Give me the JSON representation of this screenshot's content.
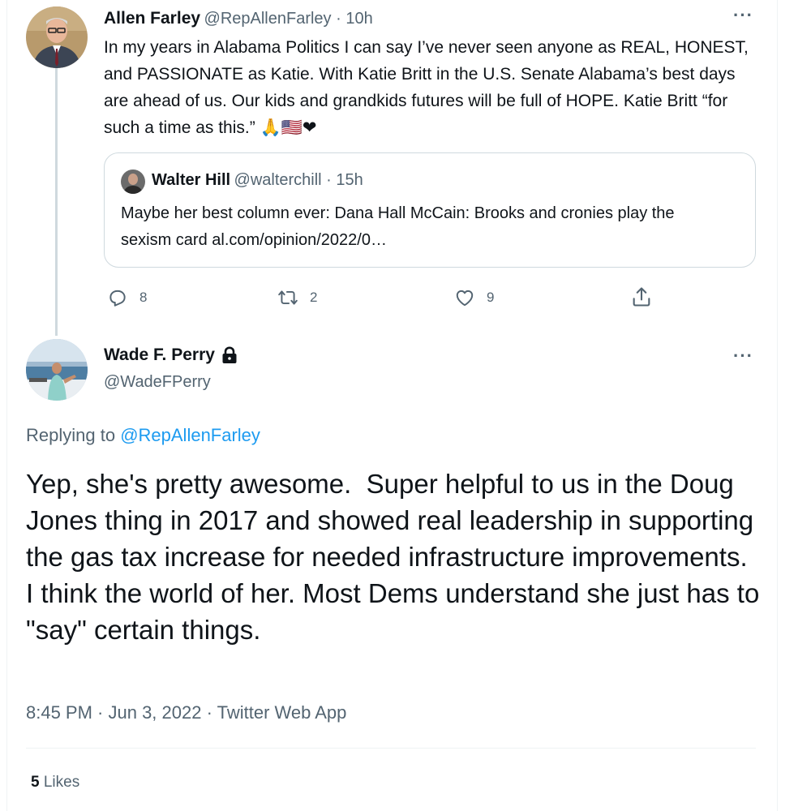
{
  "colors": {
    "accent": "#1d9bf0",
    "muted": "#536471",
    "text": "#0f1419",
    "border": "#cfd9de"
  },
  "parent_tweet": {
    "author_name": "Allen Farley",
    "handle_and_time": "@RepAllenFarley · 10h",
    "text": "In my years in Alabama Politics I can say I’ve never seen anyone as REAL, HONEST, and PASSIONATE as Katie. With Katie Britt in the U.S. Senate Alabama’s best days are ahead of us. Our kids and grandkids futures will be full of HOPE. Katie Britt “for such a time as this.”",
    "emoji": "🙏🇺🇸❤",
    "more_icon": "more-horizontal-icon",
    "quote": {
      "author_name": "Walter Hill",
      "handle_and_time": "@walterchill · 15h",
      "text": "Maybe her best column ever: Dana Hall McCain: Brooks and cronies play the sexism card al.com/opinion/2022/0…"
    },
    "actions": {
      "reply_count": "8",
      "retweet_count": "2",
      "like_count": "9",
      "icons": [
        "reply-icon",
        "retweet-icon",
        "like-icon",
        "share-icon"
      ]
    }
  },
  "main_tweet": {
    "author_name": "Wade F. Perry",
    "handle": "@WadeFPerry",
    "lock_icon": "lock-icon",
    "replying_to_prefix": "Replying to ",
    "replying_to_handle": "@RepAllenFarley",
    "text": "Yep, she's pretty awesome.  Super helpful to us in the Doug Jones thing in 2017 and showed real leadership in supporting the gas tax increase for needed infrastructure improvements.   I think the world of her. Most Dems understand she just has to \"say\" certain things.",
    "timestamp": "8:45 PM · Jun 3, 2022 · Twitter Web App",
    "likes_count": "5",
    "likes_label": " Likes"
  }
}
